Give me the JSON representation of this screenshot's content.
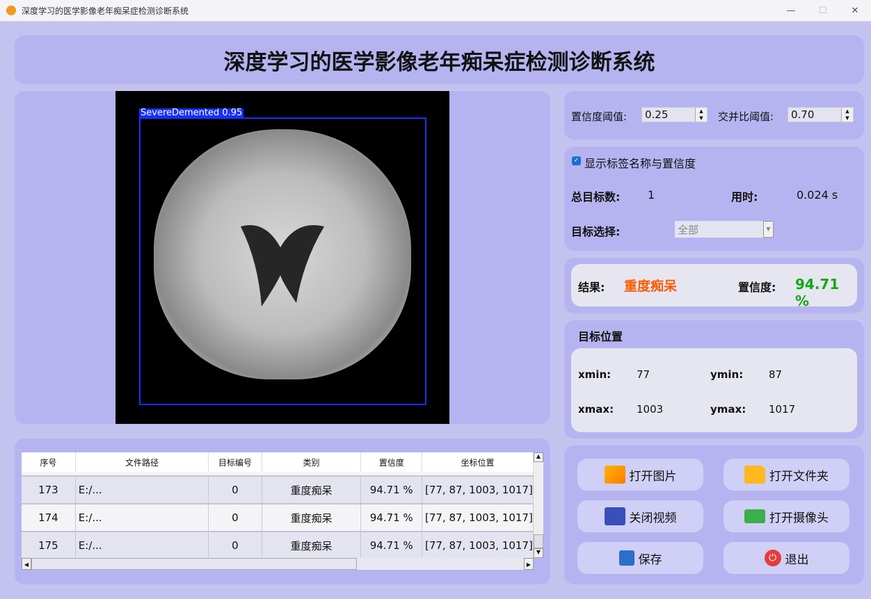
{
  "window": {
    "title": "深度学习的医学影像老年痴呆症检测诊断系统",
    "min": "—",
    "max": "☐",
    "close": "✕"
  },
  "header": {
    "title": "深度学习的医学影像老年痴呆症检测诊断系统"
  },
  "image": {
    "detection_label": "SevereDemented  0.95",
    "box_color": "#1530ff"
  },
  "settings": {
    "conf_label": "置信度阈值:",
    "conf_value": "0.25",
    "iou_label": "交并比阈值:",
    "iou_value": "0.70"
  },
  "info": {
    "show_label": "显示标签名称与置信度",
    "show_checked": true,
    "total_label": "总目标数:",
    "total_value": "1",
    "time_label": "用时:",
    "time_value": "0.024 s",
    "select_label": "目标选择:",
    "select_value": "全部"
  },
  "result": {
    "label": "结果:",
    "value": "重度痴呆",
    "value_color": "#ff5a00",
    "conf_label": "置信度:",
    "conf_value": "94.71 %",
    "conf_color": "#12a812"
  },
  "position": {
    "title": "目标位置",
    "xmin_label": "xmin:",
    "xmin": "77",
    "ymin_label": "ymin:",
    "ymin": "87",
    "xmax_label": "xmax:",
    "xmax": "1003",
    "ymax_label": "ymax:",
    "ymax": "1017"
  },
  "buttons": {
    "open_image": "打开图片",
    "open_folder": "打开文件夹",
    "close_video": "关闭视频",
    "open_camera": "打开摄像头",
    "save": "保存",
    "exit": "退出"
  },
  "table": {
    "columns": [
      "序号",
      "文件路径",
      "目标编号",
      "类别",
      "置信度",
      "坐标位置"
    ],
    "rows": [
      [
        "173",
        "E:/...",
        "0",
        "重度痴呆",
        "94.71 %",
        "[77, 87, 1003, 1017]"
      ],
      [
        "174",
        "E:/...",
        "0",
        "重度痴呆",
        "94.71 %",
        "[77, 87, 1003, 1017]"
      ],
      [
        "175",
        "E:/...",
        "0",
        "重度痴呆",
        "94.71 %",
        "[77, 87, 1003, 1017]"
      ]
    ]
  }
}
